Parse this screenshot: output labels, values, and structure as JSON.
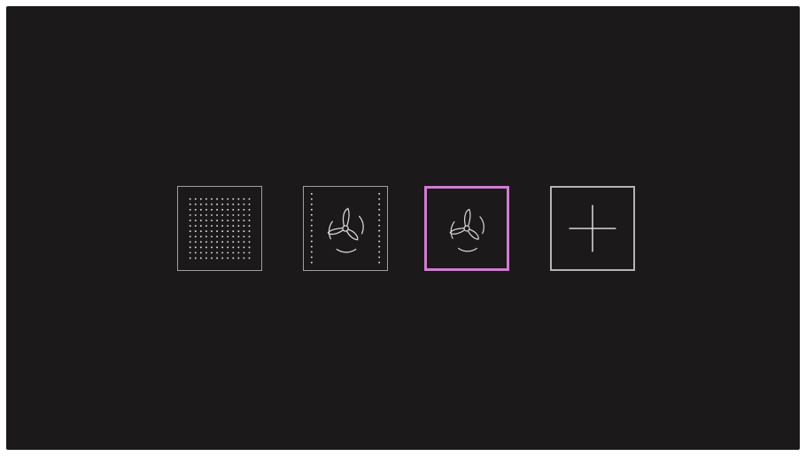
{
  "screen": {
    "background": "#1b1919"
  },
  "modes": [
    {
      "id": "mode-full-surface",
      "icon": "dot-grid-icon",
      "selected": false
    },
    {
      "id": "mode-fan-side-rows",
      "icon": "fan-with-side-dots-icon",
      "selected": false
    },
    {
      "id": "mode-fan",
      "icon": "fan-icon",
      "selected": true
    },
    {
      "id": "mode-add",
      "icon": "plus-icon",
      "selected": false
    }
  ],
  "colors": {
    "tile_border": "#a19f9f",
    "selected_border": "#d07cd0",
    "icon_stroke": "#d8d6d6"
  }
}
